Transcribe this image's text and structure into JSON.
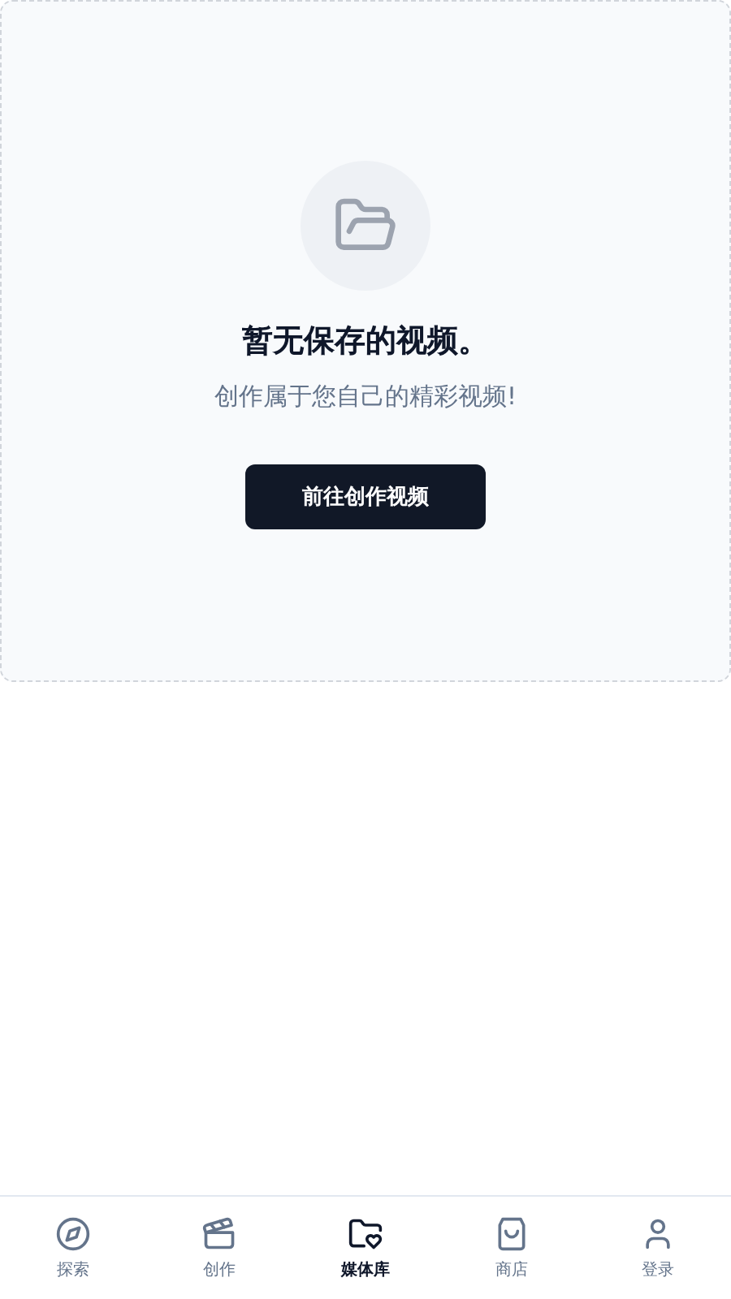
{
  "empty_state": {
    "title": "暂无保存的视频。",
    "subtitle": "创作属于您自己的精彩视频!",
    "button": "前往创作视频"
  },
  "nav": [
    {
      "label": "探索",
      "kind": "compass",
      "selected": false
    },
    {
      "label": "创作",
      "kind": "clapperboard",
      "selected": false
    },
    {
      "label": "媒体库",
      "kind": "folder-heart",
      "selected": true
    },
    {
      "label": "商店",
      "kind": "bag",
      "selected": false
    },
    {
      "label": "登录",
      "kind": "user",
      "selected": false
    }
  ]
}
